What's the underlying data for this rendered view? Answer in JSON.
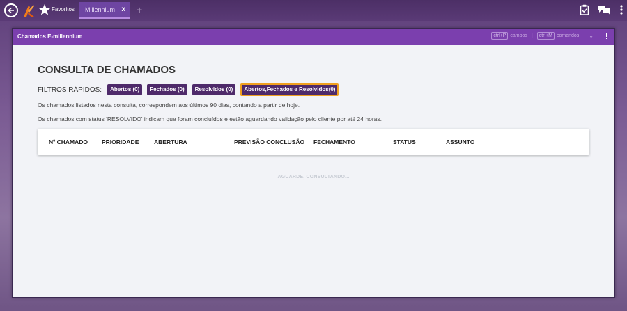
{
  "browser": {
    "favorites_label": "Favoritos",
    "tab_label": "Millennium",
    "tab_close": "x",
    "tab_add": "+",
    "icons": [
      "back-icon",
      "logo-icon",
      "star-icon",
      "clipboard-icon",
      "chat-icon",
      "kebab-menu-icon"
    ]
  },
  "window": {
    "title": "Chamados E-millennium",
    "shortcut_fields_key": "ctrl+P",
    "shortcut_fields_label": "campos",
    "shortcut_separator": "|",
    "shortcut_commands_key": "ctrl+M",
    "shortcut_commands_label": "comandos",
    "chevron": "⌄"
  },
  "page": {
    "title": "CONSULTA DE CHAMADOS",
    "filters_label": "FILTROS RÁPIDOS:",
    "filters": [
      {
        "label": "Abertos (0)"
      },
      {
        "label": "Fechados (0)"
      },
      {
        "label": "Resolvidos (0)"
      },
      {
        "label": "Abertos,Fechados e Resolvidos(0)",
        "active": true
      }
    ],
    "info_line_1": "Os chamados listados nesta consulta, correspondem aos últimos 90 dias, contando a partir de hoje.",
    "info_line_2": "Os chamados com status 'RESOLVIDO' indicam que foram concluídos e estão aguardando validação pelo cliente por até 24 horas."
  },
  "table": {
    "columns": [
      "Nº CHAMADO",
      "PRIORIDADE",
      "ABERTURA",
      "PREVISÃO CONCLUSÃO",
      "FECHAMENTO",
      "STATUS",
      "ASSUNTO"
    ]
  },
  "status": {
    "loading": "AGUARDE, CONSULTANDO..."
  },
  "colors": {
    "header_purple": "#7b3fae",
    "chip_purple": "#4e2a6a",
    "active_border": "#f0a020"
  }
}
